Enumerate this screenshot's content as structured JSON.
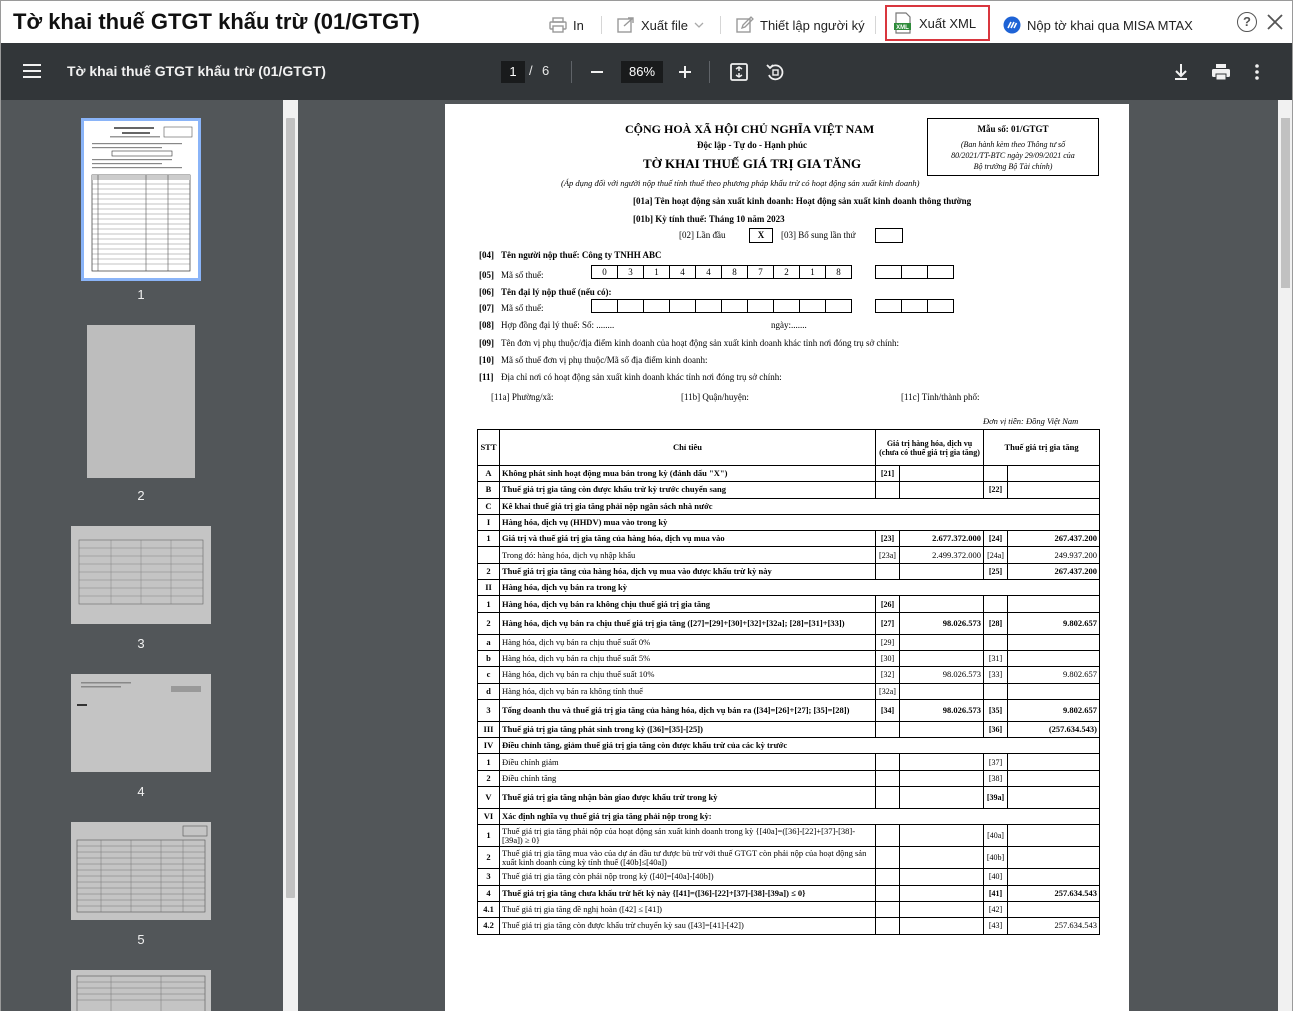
{
  "dialog": {
    "title": "Tờ khai thuế GTGT khấu trừ (01/GTGT)",
    "toolbar": {
      "print": "In",
      "export_file": "Xuất file",
      "setup_signer": "Thiết lập người ký",
      "export_xml": "Xuất XML",
      "submit_mtax": "Nộp tờ khai qua MISA MTAX"
    },
    "help": "?"
  },
  "viewer": {
    "title": "Tờ khai thuế GTGT khấu trừ (01/GTGT)",
    "page_current": "1",
    "page_sep": "/",
    "page_total": "6",
    "zoom": "86%"
  },
  "thumbnails": [
    {
      "label": "1"
    },
    {
      "label": "2"
    },
    {
      "label": "3"
    },
    {
      "label": "4"
    },
    {
      "label": "5"
    }
  ],
  "form": {
    "country": "CỘNG HOÀ XÃ HỘI CHỦ NGHĨA VIỆT NAM",
    "motto": "Độc lập - Tự do - Hạnh phúc",
    "title": "TỜ KHAI THUẾ GIÁ TRỊ GIA TĂNG",
    "subtitle": "(Áp dụng đối với người nộp thuế tính thuế theo phương pháp khấu trừ có hoạt động sản xuất kinh doanh)",
    "form_no": "Mẫu số: 01/GTGT",
    "form_note1": "(Ban hành kèm theo Thông tư số",
    "form_note2": "80/2021/TT-BTC ngày 29/09/2021 của",
    "form_note3": "Bộ trưởng Bộ Tài chính)",
    "f01a": "[01a] Tên hoạt động sản xuất kinh doanh: Hoạt động sản xuất kinh doanh thông thường",
    "f01b": "[01b] Kỳ tính thuế: Tháng 10 năm 2023",
    "f02_label": "[02] Lần đầu",
    "f02_mark": "X",
    "f03_label": "[03] Bổ sung lần thứ",
    "f04_code": "[04]",
    "f04": "Tên người nộp thuế: Công ty TNHH ABC",
    "f05_code": "[05]",
    "f05": "Mã số thuế:",
    "tax_code": [
      "0",
      "3",
      "1",
      "4",
      "4",
      "8",
      "7",
      "2",
      "1",
      "8"
    ],
    "f06_code": "[06]",
    "f06": "Tên đại lý nộp thuế (nếu có):",
    "f07_code": "[07]",
    "f07": "Mã số thuế:",
    "f08_code": "[08]",
    "f08": "Hợp đồng đại lý thuế: Số: ........",
    "f08_date": "ngày:.......",
    "f09_code": "[09]",
    "f09": "Tên đơn vị phụ thuộc/địa điểm kinh doanh của hoạt động sản xuất kinh doanh khác tỉnh nơi đóng trụ sở chính:",
    "f10_code": "[10]",
    "f10": "Mã số thuế đơn vị phụ thuộc/Mã số địa điểm kinh doanh:",
    "f11_code": "[11]",
    "f11": "Địa chỉ nơi có hoạt động sản xuất kinh doanh khác tỉnh nơi đóng trụ sở chính:",
    "f11a": "[11a] Phường/xã:",
    "f11b": "[11b] Quận/huyện:",
    "f11c": "[11c] Tỉnh/thành phố:",
    "currency": "Đơn vị tiền: Đồng Việt Nam",
    "headers": [
      "STT",
      "Chỉ tiêu",
      "Giá trị hàng hóa, dịch vụ (chưa có thuế giá trị gia tăng)",
      "Thuế giá trị gia tăng"
    ],
    "rows": [
      {
        "stt": "A",
        "label": "Không phát sinh hoạt động mua bán trong kỳ (đánh dấu \"X\")",
        "c1": "[21]",
        "v1": "",
        "c2": "",
        "v2": "",
        "bold": true
      },
      {
        "stt": "B",
        "label": "Thuế giá trị gia tăng còn được khấu trừ kỳ trước chuyển sang",
        "c1": "",
        "v1": "",
        "c2": "[22]",
        "v2": "",
        "bold": true
      },
      {
        "stt": "C",
        "label": "Kê khai thuế giá trị gia tăng phải nộp ngân sách nhà nước",
        "c1": "",
        "v1": "",
        "c2": "",
        "v2": "",
        "bold": true,
        "span": true
      },
      {
        "stt": "I",
        "label": "Hàng hóa, dịch vụ (HHDV) mua vào trong kỳ",
        "c1": "",
        "v1": "",
        "c2": "",
        "v2": "",
        "bold": true,
        "span": true
      },
      {
        "stt": "1",
        "label": "Giá trị và thuế giá trị gia tăng của hàng hóa, dịch vụ mua vào",
        "c1": "[23]",
        "v1": "2.677.372.000",
        "c2": "[24]",
        "v2": "267.437.200",
        "bold": true
      },
      {
        "stt": "",
        "label": "Trong đó: hàng hóa, dịch vụ nhập khẩu",
        "c1": "[23a]",
        "v1": "2.499.372.000",
        "c2": "[24a]",
        "v2": "249.937.200"
      },
      {
        "stt": "2",
        "label": "Thuế giá trị gia tăng của hàng hóa, dịch vụ mua vào được khấu trừ kỳ này",
        "c1": "",
        "v1": "",
        "c2": "[25]",
        "v2": "267.437.200",
        "bold": true
      },
      {
        "stt": "II",
        "label": "Hàng hóa, dịch vụ bán ra trong kỳ",
        "c1": "",
        "v1": "",
        "c2": "",
        "v2": "",
        "bold": true,
        "span": true
      },
      {
        "stt": "1",
        "label": "Hàng hóa, dịch vụ bán ra không chịu thuế giá trị gia tăng",
        "c1": "[26]",
        "v1": "",
        "c2": "",
        "v2": "",
        "bold": true
      },
      {
        "stt": "2",
        "label": "Hàng hóa, dịch vụ bán ra chịu thuế giá trị gia tăng ([27]=[29]+[30]+[32]+[32a]; [28]=[31]+[33])",
        "c1": "[27]",
        "v1": "98.026.573",
        "c2": "[28]",
        "v2": "9.802.657",
        "bold": true,
        "tall": true
      },
      {
        "stt": "a",
        "label": "Hàng hóa, dịch vụ bán ra chịu thuế suất 0%",
        "c1": "[29]",
        "v1": "",
        "c2": "",
        "v2": ""
      },
      {
        "stt": "b",
        "label": "Hàng hóa, dịch vụ bán ra chịu thuế suất 5%",
        "c1": "[30]",
        "v1": "",
        "c2": "[31]",
        "v2": ""
      },
      {
        "stt": "c",
        "label": "Hàng hóa, dịch vụ bán ra chịu thuế suất 10%",
        "c1": "[32]",
        "v1": "98.026.573",
        "c2": "[33]",
        "v2": "9.802.657"
      },
      {
        "stt": "d",
        "label": "Hàng hóa, dịch vụ bán ra không tính thuế",
        "c1": "[32a]",
        "v1": "",
        "c2": "",
        "v2": ""
      },
      {
        "stt": "3",
        "label": "Tổng doanh thu và thuế giá trị gia tăng của hàng hóa, dịch vụ bán ra ([34]=[26]+[27]; [35]=[28])",
        "c1": "[34]",
        "v1": "98.026.573",
        "c2": "[35]",
        "v2": "9.802.657",
        "bold": true,
        "tall": true
      },
      {
        "stt": "III",
        "label": "Thuế giá trị gia tăng phát sinh trong kỳ ([36]=[35]-[25])",
        "c1": "",
        "v1": "",
        "c2": "[36]",
        "v2": "(257.634.543)",
        "bold": true
      },
      {
        "stt": "IV",
        "label": "Điều chỉnh tăng, giảm thuế giá trị gia tăng còn được khấu trừ của các kỳ trước",
        "c1": "",
        "v1": "",
        "c2": "",
        "v2": "",
        "bold": true,
        "span": true
      },
      {
        "stt": "1",
        "label": "Điều chỉnh giảm",
        "c1": "",
        "v1": "",
        "c2": "[37]",
        "v2": ""
      },
      {
        "stt": "2",
        "label": "Điều chỉnh tăng",
        "c1": "",
        "v1": "",
        "c2": "[38]",
        "v2": ""
      },
      {
        "stt": "V",
        "label": "Thuế giá trị gia tăng nhận bàn giao được khấu trừ trong kỳ",
        "c1": "",
        "v1": "",
        "c2": "[39a]",
        "v2": "",
        "bold": true,
        "tall": true
      },
      {
        "stt": "VI",
        "label": "Xác định nghĩa vụ thuế giá trị gia tăng phải nộp trong kỳ:",
        "c1": "",
        "v1": "",
        "c2": "",
        "v2": "",
        "bold": true,
        "span": true
      },
      {
        "stt": "1",
        "label": "Thuế giá trị gia tăng phải nộp của hoạt động sản xuất kinh doanh trong kỳ {[40a]=([36]-[22]+[37]-[38]-[39a]) ≥ 0}",
        "c1": "",
        "v1": "",
        "c2": "[40a]",
        "v2": "",
        "tall": true
      },
      {
        "stt": "2",
        "label": "Thuế giá trị gia tăng mua vào của dự án đầu tư được bù trừ với thuế GTGT còn phải nộp của hoạt động sản xuất kinh doanh cùng kỳ tính thuế ([40b]≤[40a])",
        "c1": "",
        "v1": "",
        "c2": "[40b]",
        "v2": "",
        "tall": true
      },
      {
        "stt": "3",
        "label": "Thuế giá trị gia tăng còn phải nộp trong kỳ ([40]=[40a]-[40b])",
        "c1": "",
        "v1": "",
        "c2": "[40]",
        "v2": ""
      },
      {
        "stt": "4",
        "label": "Thuế giá trị gia tăng chưa khấu trừ hết kỳ này {[41]=([36]-[22]+[37]-[38]-[39a]) ≤ 0}",
        "c1": "",
        "v1": "",
        "c2": "[41]",
        "v2": "257.634.543",
        "bold": true
      },
      {
        "stt": "4.1",
        "label": "Thuế giá trị gia tăng đề nghị hoàn ([42] ≤ [41])",
        "c1": "",
        "v1": "",
        "c2": "[42]",
        "v2": ""
      },
      {
        "stt": "4.2",
        "label": "Thuế giá trị gia tăng còn được khấu trừ chuyển kỳ sau ([43]=[41]-[42])",
        "c1": "",
        "v1": "",
        "c2": "[43]",
        "v2": "257.634.543"
      }
    ]
  }
}
